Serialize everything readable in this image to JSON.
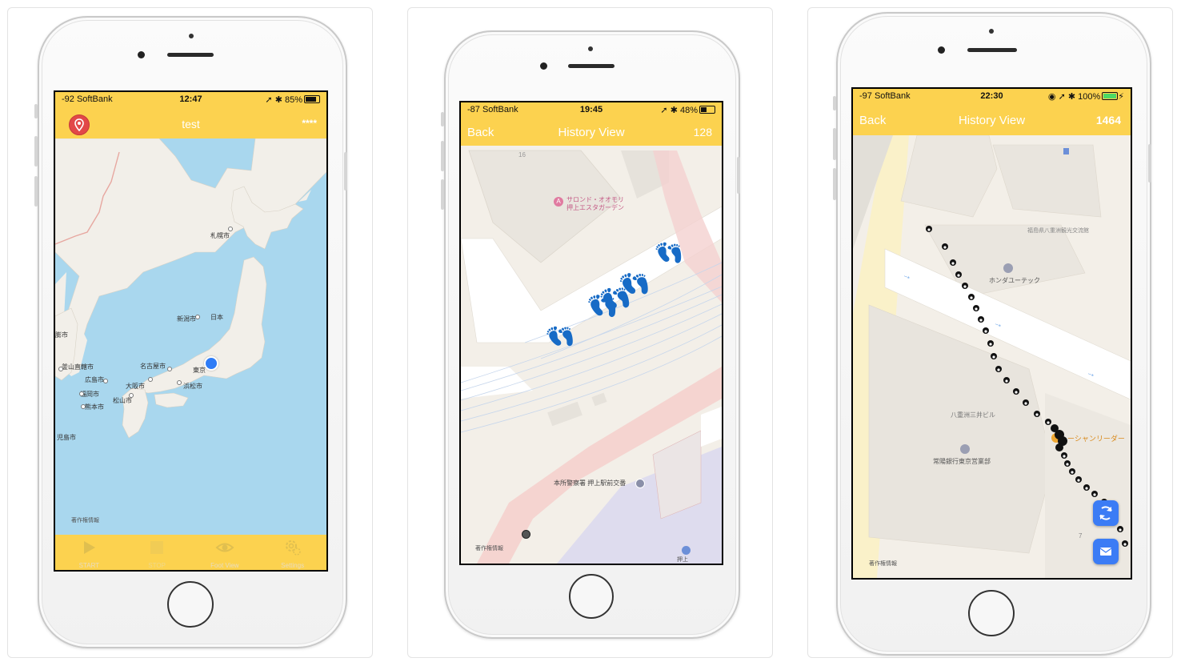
{
  "screen1": {
    "status": {
      "carrier": "-92 SoftBank",
      "time": "12:47",
      "battery": "85%"
    },
    "nav": {
      "title": "test",
      "right_label": "****"
    },
    "map": {
      "cities": [
        "札幌市",
        "新潟市",
        "日本",
        "名古屋市",
        "東京",
        "大阪市",
        "浜松市",
        "広島市",
        "福岡市",
        "松山市",
        "熊本市",
        "児島市",
        "釜山直轄市",
        "膨市"
      ],
      "legal": "著作権情報"
    },
    "tabs": [
      {
        "label": "START",
        "icon": "play-icon"
      },
      {
        "label": "STOP",
        "icon": "stop-icon"
      },
      {
        "label": "Foot View",
        "icon": "eye-icon"
      },
      {
        "label": "Settings",
        "icon": "gear-icon"
      }
    ],
    "colors": {
      "bar": "#fcd24f",
      "sea": "#a9d7ee",
      "land": "#f2efe9",
      "location": "#2f7cf6"
    }
  },
  "screen2": {
    "status": {
      "carrier": "-87 SoftBank",
      "time": "19:45",
      "battery": "48%"
    },
    "nav": {
      "back_label": "Back",
      "title": "History View",
      "count": "128"
    },
    "map": {
      "poi_name_line1": "サロンド・オオモリ",
      "poi_name_line2": "押上エスタガーデン",
      "block_number": "16",
      "police_label": "本所警察署 押上駅前交番",
      "station_label": "押上",
      "legal": "著作権情報"
    }
  },
  "screen3": {
    "status": {
      "carrier": "-97 SoftBank",
      "time": "22:30",
      "battery": "100%"
    },
    "nav": {
      "back_label": "Back",
      "title": "History View",
      "count": "1464"
    },
    "map": {
      "labels": {
        "honda": "ホンダユーテック",
        "fukushima": "福島県八重洲観光交流館",
        "mitsui": "八重洲三井ビル",
        "joyo": "常陽銀行東京営業部",
        "shangri": "ーシャンリーダー"
      },
      "block_number": "7",
      "legal": "著作権情報"
    }
  }
}
